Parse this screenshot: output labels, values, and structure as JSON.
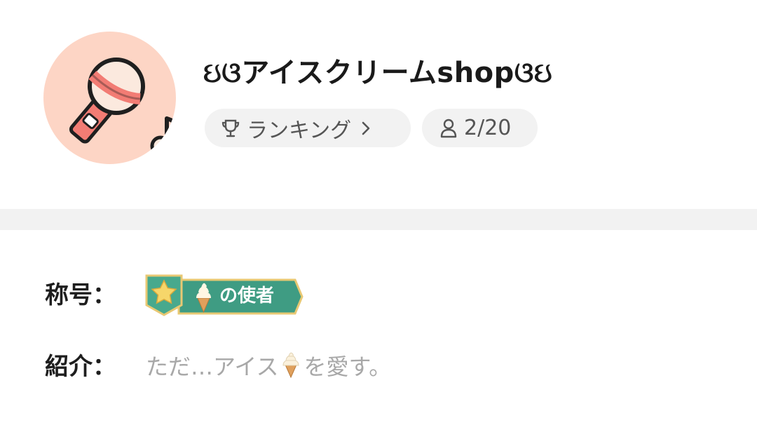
{
  "room": {
    "title": "ઇଓアイスクリームshopଓઇ",
    "ranking_label": "ランキング",
    "members_count": "2/20"
  },
  "icons": {
    "avatar": "karaoke-microphone-icon",
    "ranking": "trophy-icon",
    "ranking_arrow": "chevron-right-icon",
    "members": "person-icon",
    "badge_star": "star-icon",
    "badge_ice_cream": "soft-serve-icon",
    "intro_ice_cream": "soft-serve-icon"
  },
  "profile": {
    "title_label": "称号：",
    "badge_text": "の使者",
    "intro_label": "紹介：",
    "intro_before": "ただ…アイス",
    "intro_after": "を愛す。"
  },
  "colors": {
    "avatar_bg": "#fdd5c5",
    "mic_accent": "#f27c74",
    "pill_bg": "#f2f2f2",
    "divider": "#f2f2f2",
    "badge_green": "#3f9c83",
    "badge_gold": "#e8c873",
    "intro_text": "#a8a8a8"
  }
}
